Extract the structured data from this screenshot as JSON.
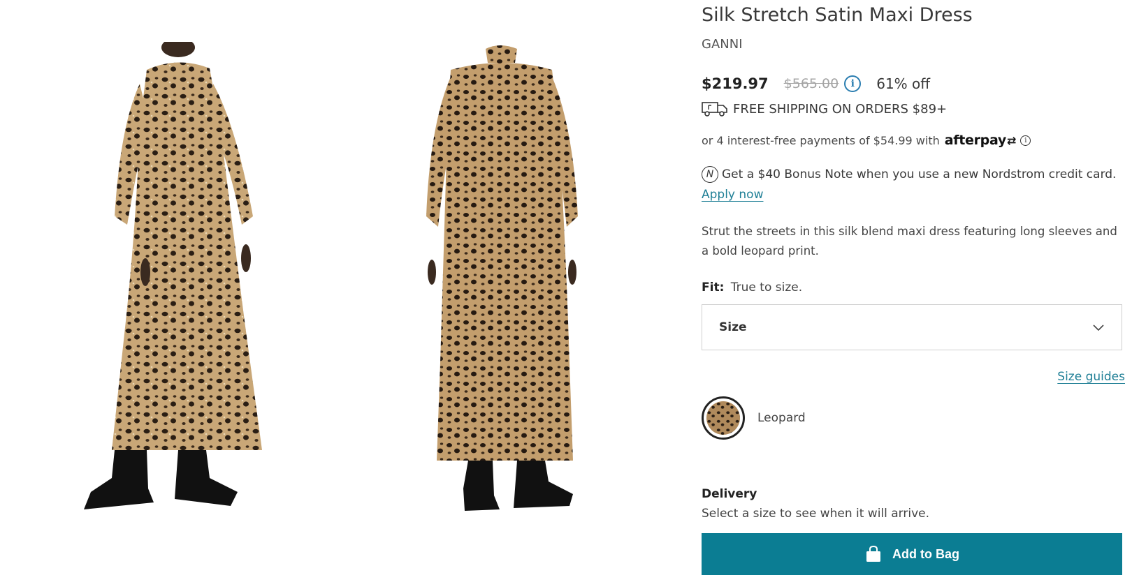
{
  "product": {
    "title": "Silk Stretch Satin Maxi Dress",
    "brand": "GANNI",
    "price_sale": "$219.97",
    "price_original": "$565.00",
    "discount": "61% off"
  },
  "shipping": {
    "text": "FREE SHIPPING ON ORDERS $89+"
  },
  "afterpay": {
    "text": "or 4 interest-free payments of $54.99 with",
    "logo_text": "afterpay"
  },
  "bonus": {
    "text": "Get a $40 Bonus Note when you use a new Nordstrom credit card.",
    "link": "Apply now"
  },
  "description": "Strut the streets in this silk blend maxi dress featuring long sleeves and a bold leopard print.",
  "fit": {
    "label": "Fit:",
    "value": "True to size."
  },
  "size_select": {
    "label": "Size"
  },
  "size_guides": "Size guides",
  "color": {
    "name": "Leopard"
  },
  "delivery": {
    "title": "Delivery",
    "text": "Select a size to see when it will arrive."
  },
  "cta": {
    "add_to_bag": "Add to Bag"
  },
  "colors": {
    "accent": "#0b7d93",
    "link": "#1f7f96",
    "info_blue": "#2a7db0"
  },
  "icons": [
    "info-icon",
    "truck-icon",
    "nordstrom-note-icon",
    "chevron-down-icon",
    "shopping-bag-icon"
  ]
}
